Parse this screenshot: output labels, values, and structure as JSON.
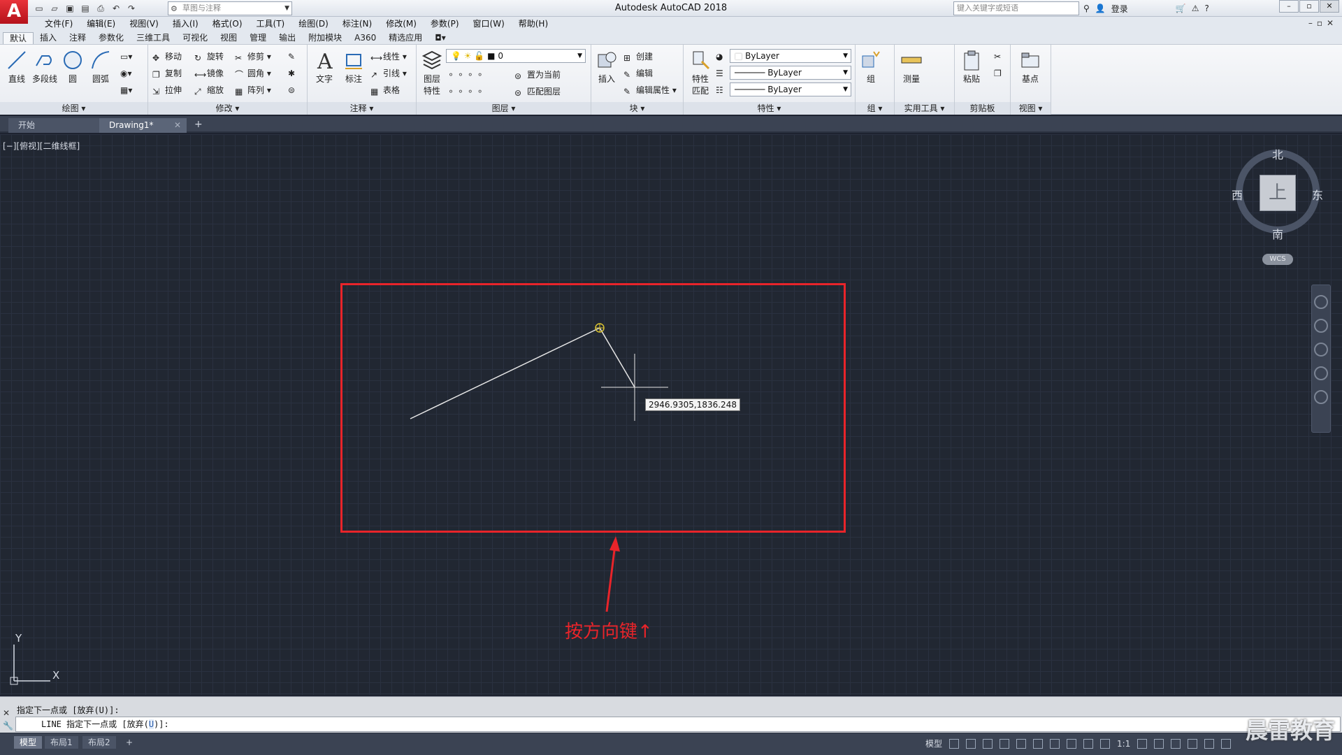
{
  "titlebar": {
    "logo": "A",
    "workspace": "草图与注释",
    "title": "Autodesk AutoCAD 2018",
    "search_placeholder": "键入关键字或短语",
    "login": "登录"
  },
  "menu": [
    "文件(F)",
    "编辑(E)",
    "视图(V)",
    "插入(I)",
    "格式(O)",
    "工具(T)",
    "绘图(D)",
    "标注(N)",
    "修改(M)",
    "参数(P)",
    "窗口(W)",
    "帮助(H)"
  ],
  "ribbon_tabs": [
    "默认",
    "插入",
    "注释",
    "参数化",
    "三维工具",
    "可视化",
    "视图",
    "管理",
    "输出",
    "附加模块",
    "A360",
    "精选应用"
  ],
  "ribbon": {
    "draw": {
      "title": "绘图",
      "line": "直线",
      "polyline": "多段线",
      "circle": "圆",
      "arc": "圆弧"
    },
    "modify": {
      "title": "修改",
      "move": "移动",
      "rotate": "旋转",
      "trim": "修剪",
      "copy": "复制",
      "mirror": "镜像",
      "fillet": "圆角",
      "stretch": "拉伸",
      "scale": "缩放",
      "array": "阵列"
    },
    "annotation": {
      "title": "注释",
      "text": "文字",
      "dimension": "标注",
      "linear": "线性",
      "leader": "引线",
      "table": "表格"
    },
    "layers": {
      "title": "图层",
      "layer_props": "图层特性",
      "current_layer": "0",
      "set_current": "置为当前",
      "match_layer": "匹配图层"
    },
    "block": {
      "title": "块",
      "insert": "插入",
      "create": "创建",
      "edit": "编辑",
      "edit_attr": "编辑属性"
    },
    "properties": {
      "title": "特性",
      "match": "特性匹配",
      "color": "ByLayer",
      "linetype": "ByLayer",
      "lineweight": "ByLayer"
    },
    "groups": {
      "title": "组",
      "group": "组"
    },
    "utilities": {
      "title": "实用工具",
      "measure": "测量"
    },
    "clipboard": {
      "title": "剪贴板",
      "paste": "粘贴"
    },
    "view": {
      "title": "视图",
      "base": "基点"
    }
  },
  "doc_tabs": {
    "start": "开始",
    "drawing": "Drawing1*"
  },
  "viewport_label": "[−][俯视][二维线框]",
  "viewcube": {
    "north": "北",
    "south": "南",
    "east": "东",
    "west": "西",
    "face": "上",
    "wcs": "WCS"
  },
  "drawing": {
    "coord_tooltip": "2946.9305,1836.248",
    "instruction": "按方向键↑"
  },
  "ucs": {
    "x": "X",
    "y": "Y"
  },
  "command": {
    "history": "指定下一点或 [放弃(U)]:",
    "prompt_cmd": "LINE",
    "prompt_text": "指定下一点或 [放弃(",
    "prompt_key": "U",
    "prompt_end": ")]:"
  },
  "layout_tabs": [
    "模型",
    "布局1",
    "布局2"
  ],
  "status": {
    "model": "模型",
    "scale": "1:1"
  },
  "watermark": "晨雷教育"
}
